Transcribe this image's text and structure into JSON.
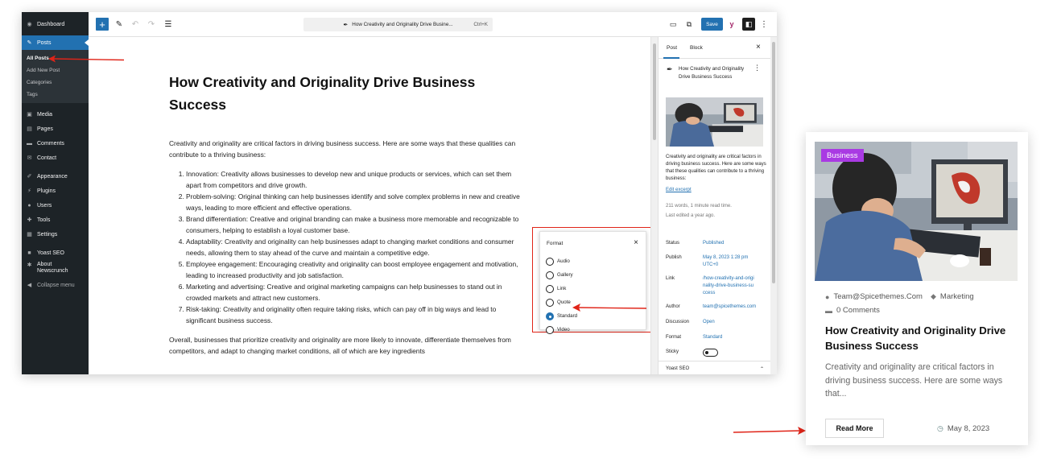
{
  "wp_menu": {
    "dashboard": "Dashboard",
    "posts": "Posts",
    "posts_sub": [
      "All Posts",
      "Add New Post",
      "Categories",
      "Tags"
    ],
    "media": "Media",
    "pages": "Pages",
    "comments": "Comments",
    "contact": "Contact",
    "appearance": "Appearance",
    "plugins": "Plugins",
    "users": "Users",
    "tools": "Tools",
    "settings": "Settings",
    "yoast": "Yoast SEO",
    "about": "About Newscrunch",
    "collapse": "Collapse menu"
  },
  "toolbar": {
    "add_label": "+",
    "command_title": "How Creativity and Originality Drive Busine...",
    "command_shortcut": "Ctrl+K",
    "save_label": "Save",
    "yoast_label": "y"
  },
  "post": {
    "title": "How Creativity and Originality Drive Business Success",
    "intro": "Creativity and originality are critical factors in driving business success. Here are some ways that these qualities can contribute to a thriving business:",
    "list": [
      "Innovation: Creativity allows businesses to develop new and unique products or services, which can set them apart from competitors and drive growth.",
      "Problem-solving: Original thinking can help businesses identify and solve complex problems in new and creative ways, leading to more efficient and effective operations.",
      "Brand differentiation: Creative and original branding can make a business more memorable and recognizable to consumers, helping to establish a loyal customer base.",
      "Adaptability: Creativity and originality can help businesses adapt to changing market conditions and consumer needs, allowing them to stay ahead of the curve and maintain a competitive edge.",
      "Employee engagement: Encouraging creativity and originality can boost employee engagement and motivation, leading to increased productivity and job satisfaction.",
      "Marketing and advertising: Creative and original marketing campaigns can help businesses to stand out in crowded markets and attract new customers.",
      "Risk-taking: Creativity and originality often require taking risks, which can pay off in big ways and lead to significant business success."
    ],
    "outro": "Overall, businesses that prioritize creativity and originality are more likely to innovate, differentiate themselves from competitors, and adapt to changing market conditions, all of which are key ingredients"
  },
  "format_popup": {
    "title": "Format",
    "close": "×",
    "options": [
      "Audio",
      "Gallery",
      "Link",
      "Quote",
      "Standard",
      "Video"
    ],
    "selected": "Standard"
  },
  "settings": {
    "tab_post": "Post",
    "tab_block": "Block",
    "close": "×",
    "doc_title": "How Creativity and Originality Drive Business Success",
    "excerpt": "Creativity and originality are critical factors in driving business success. Here are some ways that these qualities can contribute to a thriving business:",
    "edit_excerpt": "Edit excerpt",
    "word_count": "211 words, 1 minute read time.",
    "last_edited": "Last edited a year ago.",
    "rows": [
      {
        "key": "Status",
        "value": "Published"
      },
      {
        "key": "Publish",
        "value": "May 8, 2023 1:28 pm UTC+0"
      },
      {
        "key": "Link",
        "value": "/how-creativity-and-originality-drive-business-success"
      },
      {
        "key": "Author",
        "value": "team@spicethemes.com"
      },
      {
        "key": "Discussion",
        "value": "Open"
      },
      {
        "key": "Format",
        "value": "Standard"
      },
      {
        "key": "Sticky",
        "value": ""
      }
    ],
    "yoast": "Yoast SEO"
  },
  "card": {
    "badge": "Business",
    "author": "Team@Spicethemes.Com",
    "category": "Marketing",
    "comments": "0 Comments",
    "title": "How Creativity and Originality Drive Business Success",
    "excerpt": "Creativity and originality are critical factors in driving business success. Here are some ways that...",
    "read_more": "Read More",
    "date": "May 8, 2023"
  },
  "colors": {
    "wp_admin_dark": "#1d2327",
    "wp_blue": "#2271b1",
    "highlight_red": "#e02418",
    "badge_purple": "#a93ae3"
  }
}
